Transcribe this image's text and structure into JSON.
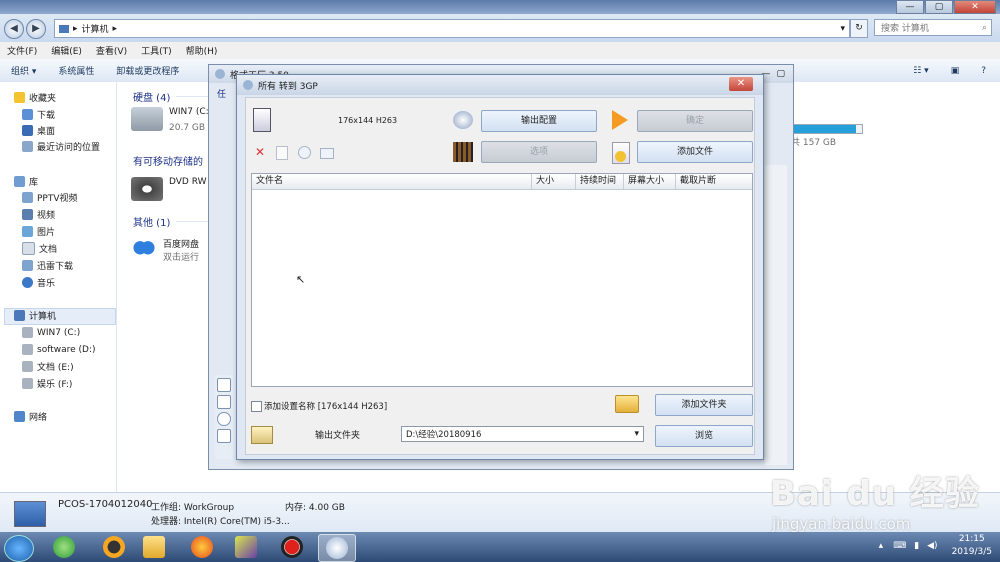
{
  "explorer": {
    "address": [
      "计算机"
    ],
    "search_placeholder": "搜索 计算机",
    "menu": [
      "文件(F)",
      "编辑(E)",
      "查看(V)",
      "工具(T)",
      "帮助(H)"
    ],
    "commands": [
      "组织 ▾",
      "系统属性",
      "卸载或更改程序"
    ],
    "nav": {
      "favorites": "收藏夹",
      "favorite_items": [
        "下载",
        "桌面",
        "最近访问的位置"
      ],
      "libraries": "库",
      "library_items": [
        "PPTV视频",
        "视频",
        "图片",
        "文档",
        "迅雷下载",
        "音乐"
      ],
      "computer": "计算机",
      "drives": [
        "WIN7 (C:)",
        "software (D:)",
        "文档 (E:)",
        "娱乐 (F:)"
      ],
      "network": "网络"
    },
    "groups": {
      "hdd": "硬盘 (4)",
      "hdd_item_name": "WIN7 (C:)",
      "hdd_item_size": "20.7 GB",
      "removable": "有可移动存储的",
      "dvd": "DVD RW",
      "other": "其他 (1)",
      "baidu_name": "百度网盘",
      "baidu_desc": "双击运行",
      "right_size": "共 157 GB",
      "hdd_bar_percent": 92
    },
    "details": {
      "pc_name": "PCOS-1704012040",
      "workgroup": "工作组: WorkGroup",
      "memory": "内存: 4.00 GB",
      "cpu": "处理器: Intel(R) Core(TM) i5-3..."
    }
  },
  "bg_window": {
    "title": "格式工厂 3.50",
    "tab": "任"
  },
  "dialog": {
    "title": "所有 转到 3GP",
    "resolution": "176x144 H263",
    "output_config": "输出配置",
    "ok": "确定",
    "options": "选项",
    "add_file": "添加文件",
    "columns": [
      "文件名",
      "大小",
      "持续时间",
      "屏幕大小",
      "截取片断"
    ],
    "add_setting_name": "添加设置名称 [176x144 H263]",
    "add_folder": "添加文件夹",
    "output_folder_label": "输出文件夹",
    "output_folder_value": "D:\\经验\\20180916",
    "browse": "浏览"
  },
  "taskbar": {
    "time": "21:15",
    "date": "2019/3/5"
  },
  "watermark": {
    "brand": "Bai du 经验",
    "url": "jingyan.baidu.com"
  },
  "colors": {
    "accent": "#2b6cc4",
    "bar": "#26a0da",
    "close": "#c3443a"
  }
}
